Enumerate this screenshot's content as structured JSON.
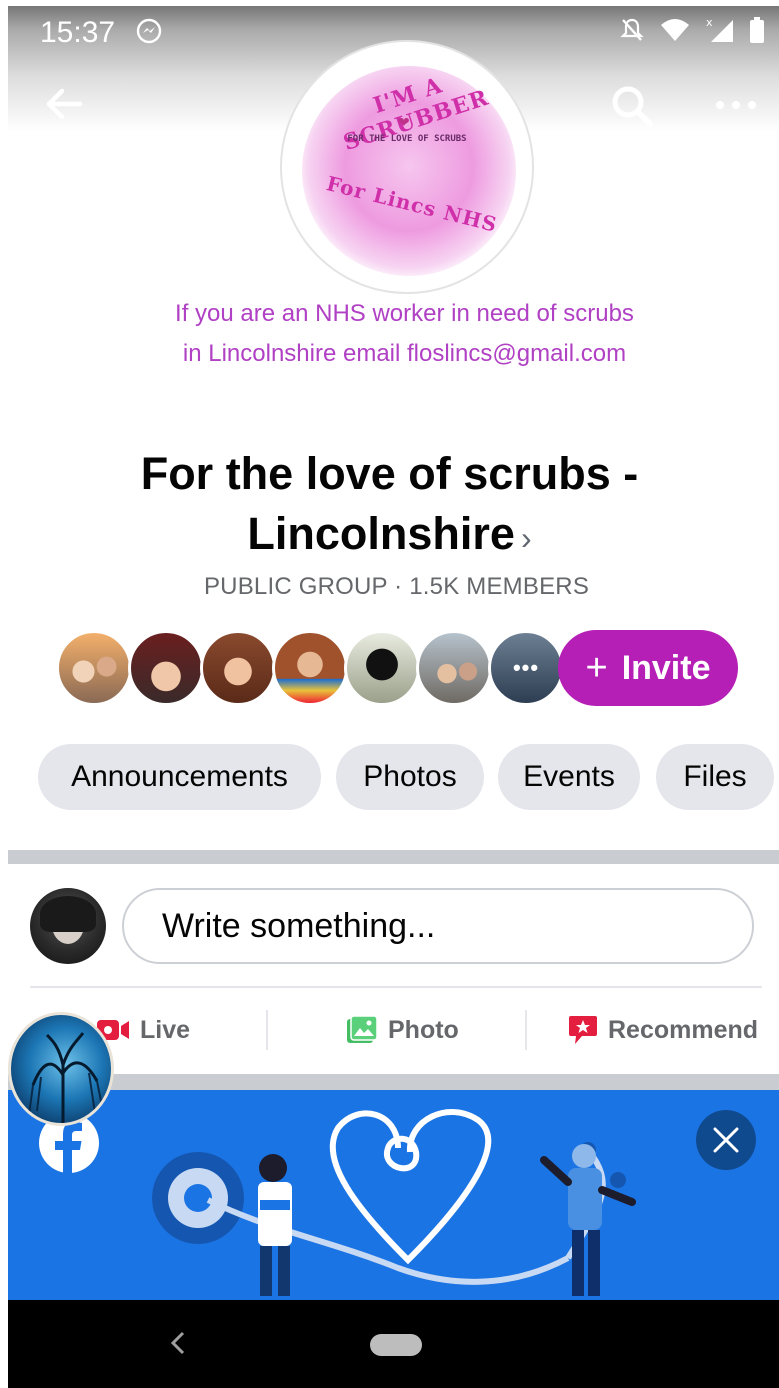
{
  "status_bar": {
    "time": "15:37",
    "icons": [
      "messenger-icon",
      "mute-icon",
      "wifi-icon",
      "signal-icon",
      "battery-icon"
    ]
  },
  "top_nav": {
    "icons": [
      "back-arrow-icon",
      "search-icon",
      "more-options-icon"
    ]
  },
  "cover": {
    "logo_top_text": "I'M A SCRUBBER",
    "logo_middle_text": "FOR THE LOVE OF SCRUBS",
    "logo_bottom_text": "For Lincs NHS",
    "caption_line1": "If you are an NHS worker in need of scrubs",
    "caption_line2": "in Lincolnshire email floslincs@gmail.com"
  },
  "group": {
    "title_line1": "For the love of scrubs -",
    "title_line2": "Lincolnshire",
    "chevron": "›",
    "meta": "PUBLIC GROUP · 1.5K MEMBERS"
  },
  "members": {
    "more_label": "•••",
    "invite_plus": "+",
    "invite_label": "Invite"
  },
  "tabs": [
    "Announcements",
    "Photos",
    "Events",
    "Files"
  ],
  "composer": {
    "placeholder": "Write something..."
  },
  "actions": {
    "live": "Live",
    "photo": "Photo",
    "recommend": "Recommend"
  },
  "banner": {
    "icons": [
      "facebook-logo-icon",
      "close-icon"
    ]
  },
  "colors": {
    "accent_purple": "#b61fb6",
    "caption_purple": "#b040c4",
    "facebook_blue": "#1b74e4",
    "chip_gray": "#e4e6eb",
    "divider_gray": "#c9ccd1"
  }
}
